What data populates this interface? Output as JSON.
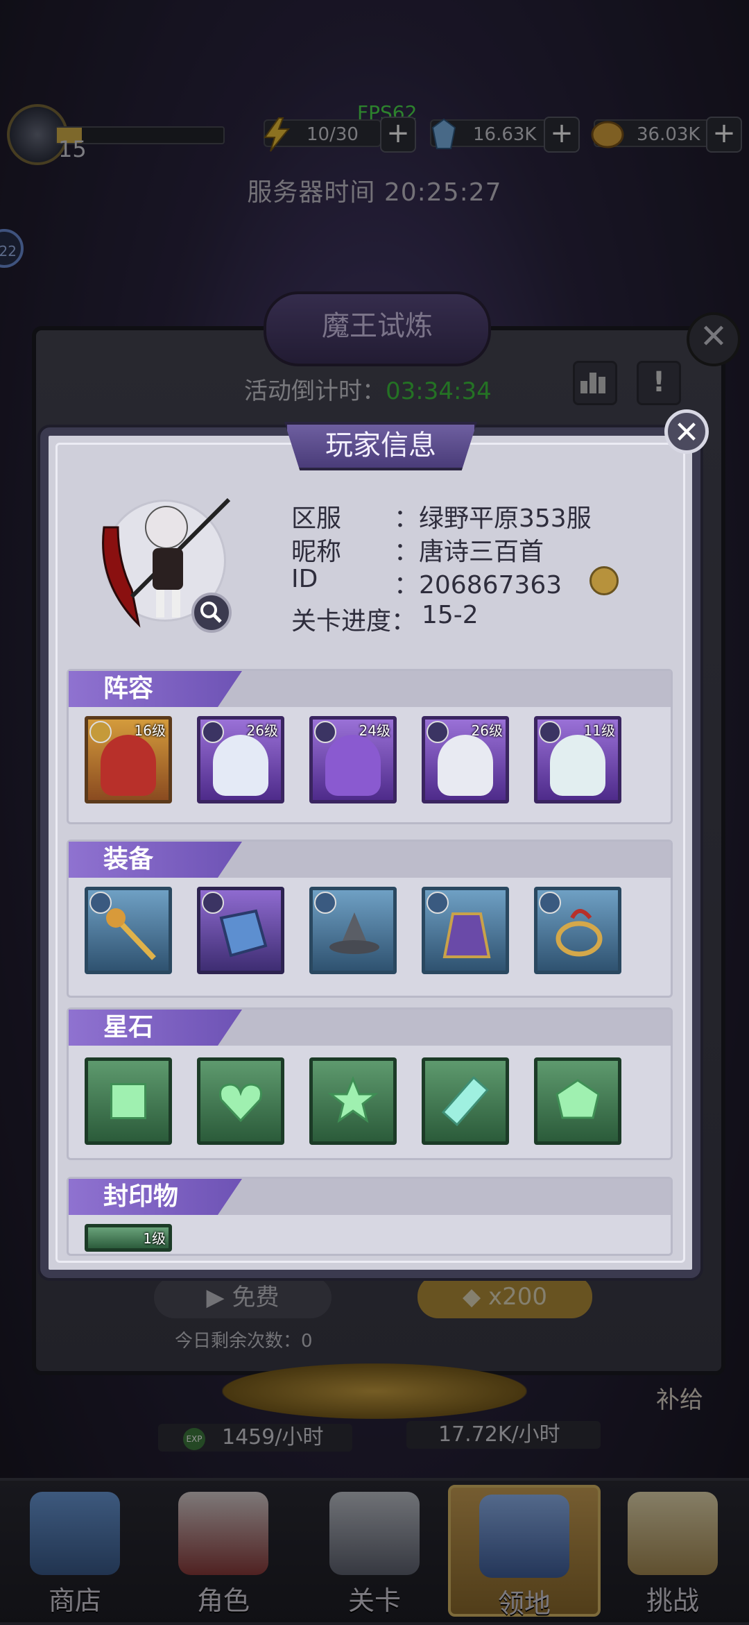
{
  "top": {
    "level": "15",
    "xp_fraction": 0.15,
    "fps": "FPS62",
    "energy": "10/30",
    "diamonds": "16.63K",
    "gold": "36.03K",
    "plus": "+"
  },
  "server_time": "服务器时间 20:25:27",
  "side_bubble": "22",
  "demon_trial": {
    "title": "魔王试炼",
    "countdown_label": "活动倒计时：",
    "countdown_value": "03:34:34",
    "free_button": "免费",
    "cost_button": "x200",
    "remaining": "今日剩余次数：0",
    "supply": "补给",
    "exp_rate": "1459/小时",
    "gold_rate": "17.72K/小时",
    "exp_badge": "EXP",
    "info_mark": "!",
    "close": "✕"
  },
  "nav": {
    "items": [
      {
        "label": "商店"
      },
      {
        "label": "角色"
      },
      {
        "label": "关卡"
      },
      {
        "label": "领地"
      },
      {
        "label": "挑战"
      }
    ]
  },
  "player_info": {
    "title": "玩家信息",
    "close": "✕",
    "fields": [
      {
        "label": "区服",
        "value": "：绿野平原353服"
      },
      {
        "label": "昵称",
        "value": "：唐诗三百首"
      },
      {
        "label": "ID",
        "value": "：206867363"
      },
      {
        "label": "关卡进度：",
        "value": "15-2"
      }
    ],
    "sections": {
      "lineup": {
        "label": "阵容",
        "heroes": [
          {
            "level": "16级",
            "rarity": "gold"
          },
          {
            "level": "26级",
            "rarity": "purple"
          },
          {
            "level": "24级",
            "rarity": "purple"
          },
          {
            "level": "26级",
            "rarity": "purple"
          },
          {
            "level": "11级",
            "rarity": "purple"
          }
        ]
      },
      "equipment": {
        "label": "装备",
        "items": [
          "staff",
          "tome",
          "wizard-hat",
          "cloak",
          "ring"
        ]
      },
      "star_stones": {
        "label": "星石",
        "items": [
          "square-gem",
          "heart-gem",
          "star-gem",
          "diamond-gem",
          "round-gem"
        ]
      },
      "seals": {
        "label": "封印物",
        "items": [
          {
            "level": "1级"
          }
        ]
      }
    }
  }
}
